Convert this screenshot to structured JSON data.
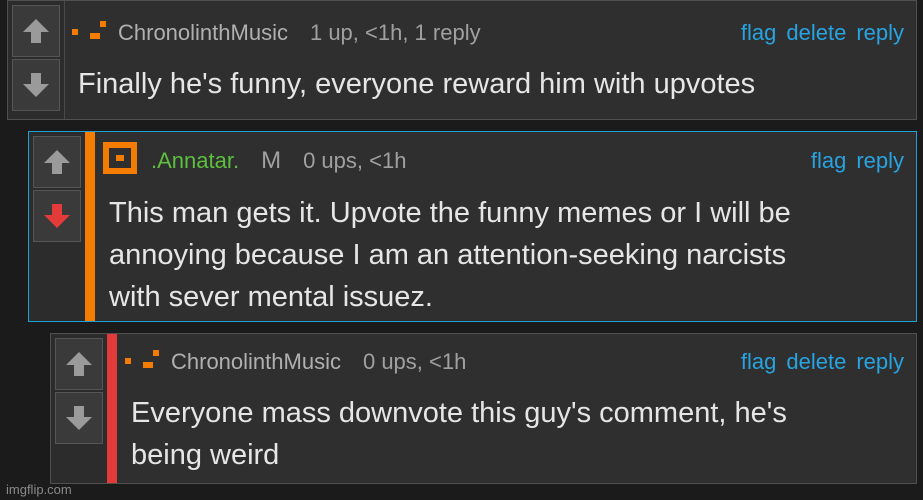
{
  "colors": {
    "link": "#27a3e0",
    "accent_orange": "#f47c00",
    "accent_red": "#e33a3a",
    "highlight_border": "#1da1d6",
    "mod_green": "#5cbf3e"
  },
  "comments": [
    {
      "username": "ChronolinthMusic",
      "meta": "1 up, <1h, 1 reply",
      "actions": [
        "flag",
        "delete",
        "reply"
      ],
      "text": "Finally he's funny, everyone reward him with upvotes",
      "upvote_icon": "arrow-up-icon",
      "downvote_icon": "arrow-down-icon"
    },
    {
      "username": ".Annatar.",
      "badge": "M",
      "meta": "0 ups, <1h",
      "actions": [
        "flag",
        "reply"
      ],
      "text": "This man gets it. Upvote the funny memes or I will be\nannoying because I am an attention-seeking narcists\nwith sever mental issuez.",
      "downvote_state": "active"
    },
    {
      "username": "ChronolinthMusic",
      "meta": "0 ups, <1h",
      "actions": [
        "flag",
        "delete",
        "reply"
      ],
      "text": "Everyone mass downvote this guy's comment, he's\nbeing weird"
    }
  ],
  "watermark": "imgflip.com"
}
